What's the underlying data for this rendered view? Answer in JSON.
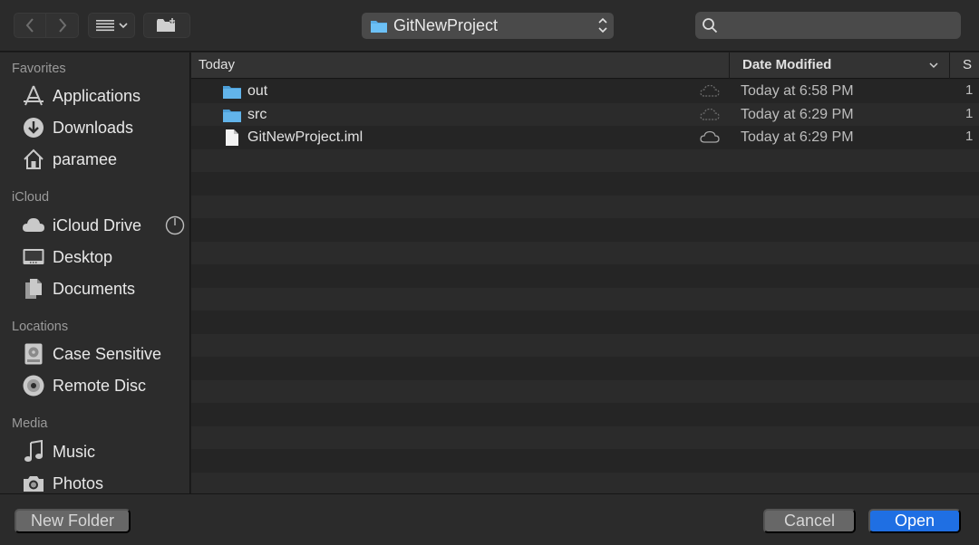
{
  "toolbar": {
    "back_icon": "chevron-left-icon",
    "forward_icon": "chevron-right-icon",
    "view_icon": "list-view-icon",
    "new_folder_icon": "folder-plus-icon",
    "location": "GitNewProject",
    "search": {
      "value": "",
      "placeholder": ""
    }
  },
  "sidebar": {
    "sections": [
      {
        "title": "Favorites",
        "items": [
          {
            "label": "Applications",
            "icon": "applications-icon"
          },
          {
            "label": "Downloads",
            "icon": "downloads-icon"
          },
          {
            "label": "paramee",
            "icon": "home-icon"
          }
        ]
      },
      {
        "title": "iCloud",
        "items": [
          {
            "label": "iCloud Drive",
            "icon": "icloud-icon"
          },
          {
            "label": "Desktop",
            "icon": "desktop-icon"
          },
          {
            "label": "Documents",
            "icon": "documents-icon"
          }
        ]
      },
      {
        "title": "Locations",
        "items": [
          {
            "label": "Case Sensitive",
            "icon": "disk-icon"
          },
          {
            "label": "Remote Disc",
            "icon": "disc-icon"
          }
        ]
      },
      {
        "title": "Media",
        "items": [
          {
            "label": "Music",
            "icon": "music-icon"
          },
          {
            "label": "Photos",
            "icon": "camera-icon"
          }
        ]
      }
    ]
  },
  "list": {
    "columns": {
      "name": "Today",
      "date": "Date Modified",
      "size": "S"
    },
    "rows": [
      {
        "name": "out",
        "type": "folder",
        "date": "Today at 6:58 PM",
        "size": "1"
      },
      {
        "name": "src",
        "type": "folder",
        "date": "Today at 6:29 PM",
        "size": "1"
      },
      {
        "name": "GitNewProject.iml",
        "type": "file",
        "date": "Today at 6:29 PM",
        "size": "1"
      }
    ]
  },
  "buttons": {
    "new_folder": "New Folder",
    "cancel": "Cancel",
    "open": "Open"
  },
  "colors": {
    "accent": "#1f6fe3",
    "folder": "#5aaee6"
  }
}
